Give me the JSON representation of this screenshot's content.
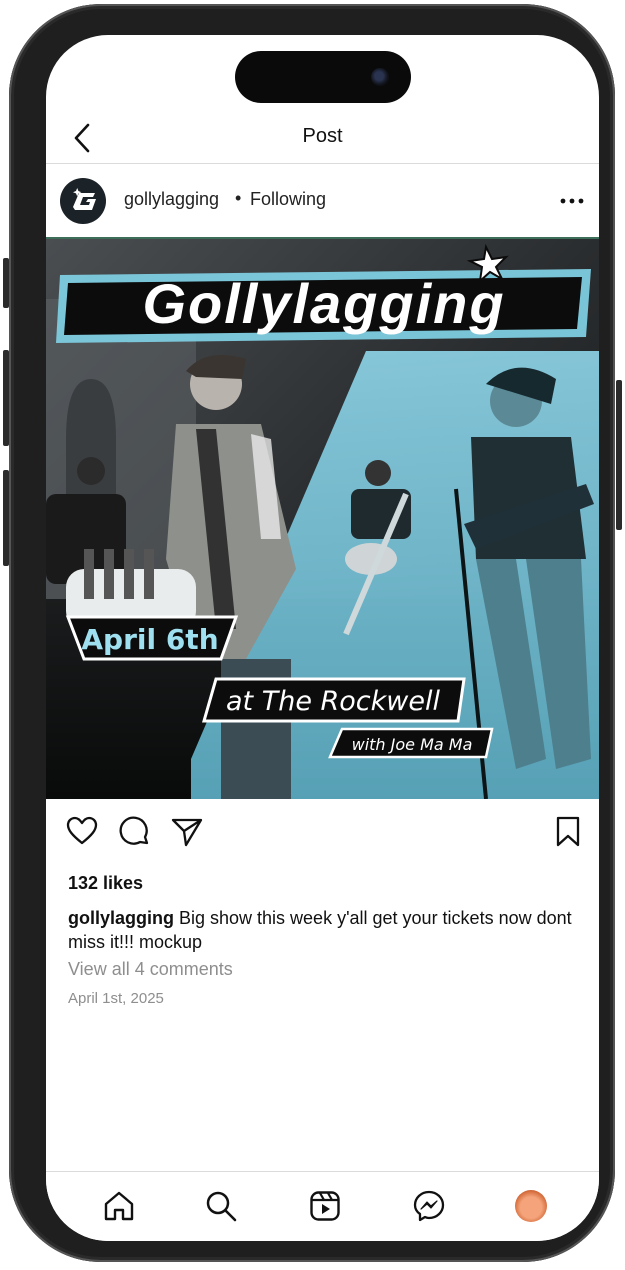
{
  "nav": {
    "title": "Post",
    "back_icon": "chevron-left-icon"
  },
  "post": {
    "username": "gollylagging",
    "separator": "•",
    "follow_state": "Following",
    "more_icon": "more-horizontal-icon",
    "image": {
      "band_logo": "Gollylagging",
      "date": "April 6th",
      "venue": "at The Rockwell",
      "support": "with Joe Ma Ma",
      "accent_color": "#7ecce0"
    },
    "likes": "132 likes",
    "caption_user": "gollylagging",
    "caption_text": " Big show this week y'all get your tickets now dont miss it!!! mockup",
    "comments_link": "View all 4 comments",
    "date": "April 1st, 2025"
  },
  "actions": [
    "heart-icon",
    "comment-icon",
    "share-icon",
    "bookmark-icon"
  ],
  "tabbar": [
    "home-icon",
    "search-icon",
    "reels-icon",
    "messenger-icon",
    "profile-avatar"
  ]
}
